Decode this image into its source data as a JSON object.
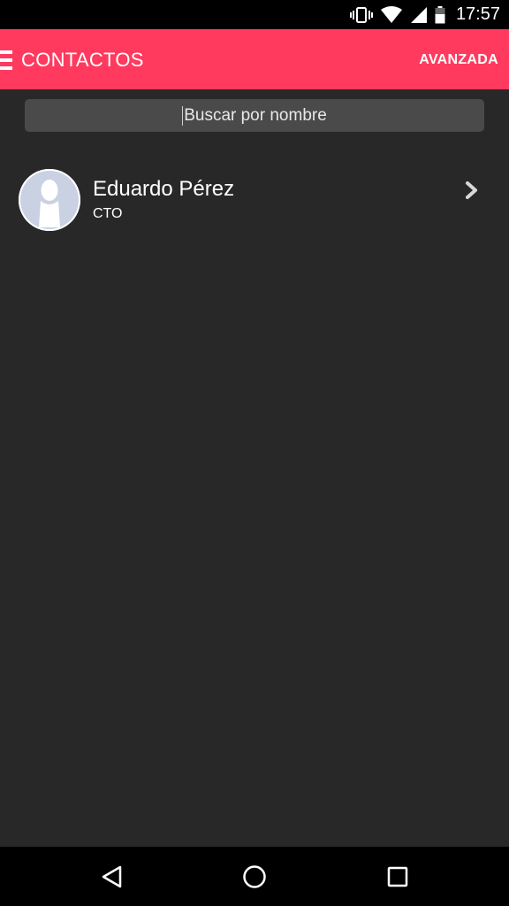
{
  "status_bar": {
    "time": "17:57",
    "icons": [
      "vibrate-icon",
      "wifi-icon",
      "signal-icon",
      "battery-icon"
    ]
  },
  "app_bar": {
    "menu_icon": "menu-icon",
    "title": "CONTACTOS",
    "action_label": "AVANZADA",
    "color": "#ff3a5e"
  },
  "search": {
    "placeholder": "Buscar por nombre",
    "value": ""
  },
  "contacts": [
    {
      "name": "Eduardo Pérez",
      "role": "CTO",
      "avatar": "default-person-avatar"
    }
  ],
  "nav_bar": {
    "icons": [
      "back-icon",
      "home-icon",
      "recents-icon"
    ]
  },
  "colors": {
    "background": "#282828",
    "accent": "#ff3a5e",
    "search_bg": "#4a4a4a"
  }
}
